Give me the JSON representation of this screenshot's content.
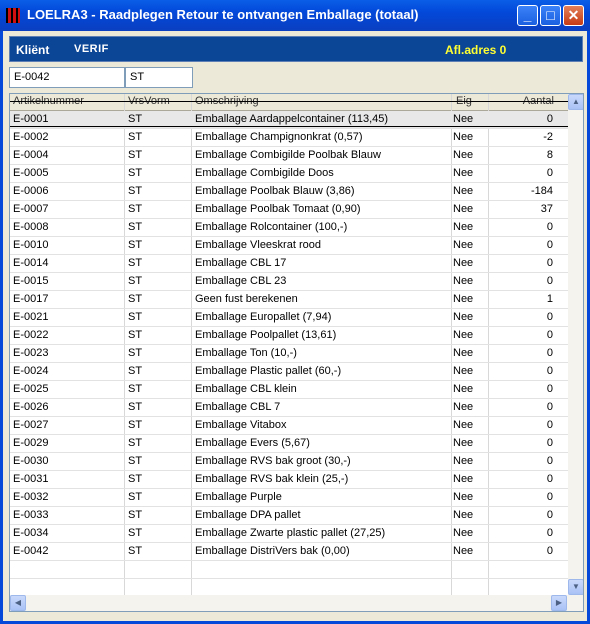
{
  "window": {
    "title": "LOELRA3 - Raadplegen Retour te ontvangen Emballage (totaal)",
    "minimize_label": "_",
    "maximize_label": "□",
    "close_label": "✕"
  },
  "infobar": {
    "klient_label": "Kliënt",
    "klient_name": "VERIF",
    "klient_code": "",
    "afl_adres": "Afl.adres 0"
  },
  "filter": {
    "article": "E-0042",
    "unit": "ST"
  },
  "grid": {
    "columns": [
      "Artikelnummer",
      "VrsVorm",
      "Omschrijving",
      "Eig",
      "Aantal"
    ],
    "rows": [
      {
        "art": "E-0001",
        "vrs": "ST",
        "oms": "Emballage Aardappelcontainer (113,45)",
        "eig": "Nee",
        "aantal": "0"
      },
      {
        "art": "E-0002",
        "vrs": "ST",
        "oms": "Emballage Champignonkrat (0,57)",
        "eig": "Nee",
        "aantal": "-2"
      },
      {
        "art": "E-0004",
        "vrs": "ST",
        "oms": "Emballage Combigilde Poolbak Blauw",
        "eig": "Nee",
        "aantal": "8"
      },
      {
        "art": "E-0005",
        "vrs": "ST",
        "oms": "Emballage Combigilde Doos",
        "eig": "Nee",
        "aantal": "0"
      },
      {
        "art": "E-0006",
        "vrs": "ST",
        "oms": "Emballage Poolbak Blauw (3,86)",
        "eig": "Nee",
        "aantal": "-184"
      },
      {
        "art": "E-0007",
        "vrs": "ST",
        "oms": "Emballage Poolbak Tomaat (0,90)",
        "eig": "Nee",
        "aantal": "37"
      },
      {
        "art": "E-0008",
        "vrs": "ST",
        "oms": "Emballage Rolcontainer (100,-)",
        "eig": "Nee",
        "aantal": "0"
      },
      {
        "art": "E-0010",
        "vrs": "ST",
        "oms": "Emballage Vleeskrat rood",
        "eig": "Nee",
        "aantal": "0"
      },
      {
        "art": "E-0014",
        "vrs": "ST",
        "oms": "Emballage CBL 17",
        "eig": "Nee",
        "aantal": "0"
      },
      {
        "art": "E-0015",
        "vrs": "ST",
        "oms": "Emballage CBL 23",
        "eig": "Nee",
        "aantal": "0"
      },
      {
        "art": "E-0017",
        "vrs": "ST",
        "oms": "Geen fust berekenen",
        "eig": "Nee",
        "aantal": "1"
      },
      {
        "art": "E-0021",
        "vrs": "ST",
        "oms": "Emballage Europallet (7,94)",
        "eig": "Nee",
        "aantal": "0"
      },
      {
        "art": "E-0022",
        "vrs": "ST",
        "oms": "Emballage Poolpallet (13,61)",
        "eig": "Nee",
        "aantal": "0"
      },
      {
        "art": "E-0023",
        "vrs": "ST",
        "oms": "Emballage Ton (10,-)",
        "eig": "Nee",
        "aantal": "0"
      },
      {
        "art": "E-0024",
        "vrs": "ST",
        "oms": "Emballage Plastic pallet (60,-)",
        "eig": "Nee",
        "aantal": "0"
      },
      {
        "art": "E-0025",
        "vrs": "ST",
        "oms": "Emballage CBL klein",
        "eig": "Nee",
        "aantal": "0"
      },
      {
        "art": "E-0026",
        "vrs": "ST",
        "oms": "Emballage CBL 7",
        "eig": "Nee",
        "aantal": "0"
      },
      {
        "art": "E-0027",
        "vrs": "ST",
        "oms": "Emballage Vitabox",
        "eig": "Nee",
        "aantal": "0"
      },
      {
        "art": "E-0029",
        "vrs": "ST",
        "oms": "Emballage Evers (5,67)",
        "eig": "Nee",
        "aantal": "0"
      },
      {
        "art": "E-0030",
        "vrs": "ST",
        "oms": "Emballage RVS bak groot (30,-)",
        "eig": "Nee",
        "aantal": "0"
      },
      {
        "art": "E-0031",
        "vrs": "ST",
        "oms": "Emballage RVS bak klein (25,-)",
        "eig": "Nee",
        "aantal": "0"
      },
      {
        "art": "E-0032",
        "vrs": "ST",
        "oms": "Emballage Purple",
        "eig": "Nee",
        "aantal": "0"
      },
      {
        "art": "E-0033",
        "vrs": "ST",
        "oms": "Emballage DPA pallet",
        "eig": "Nee",
        "aantal": "0"
      },
      {
        "art": "E-0034",
        "vrs": "ST",
        "oms": "Emballage Zwarte plastic pallet (27,25)",
        "eig": "Nee",
        "aantal": "0"
      },
      {
        "art": "E-0042",
        "vrs": "ST",
        "oms": "Emballage DistriVers bak (0,00)",
        "eig": "Nee",
        "aantal": "0"
      }
    ]
  },
  "scroll": {
    "up": "▲",
    "down": "▼",
    "left": "◀",
    "right": "▶"
  }
}
